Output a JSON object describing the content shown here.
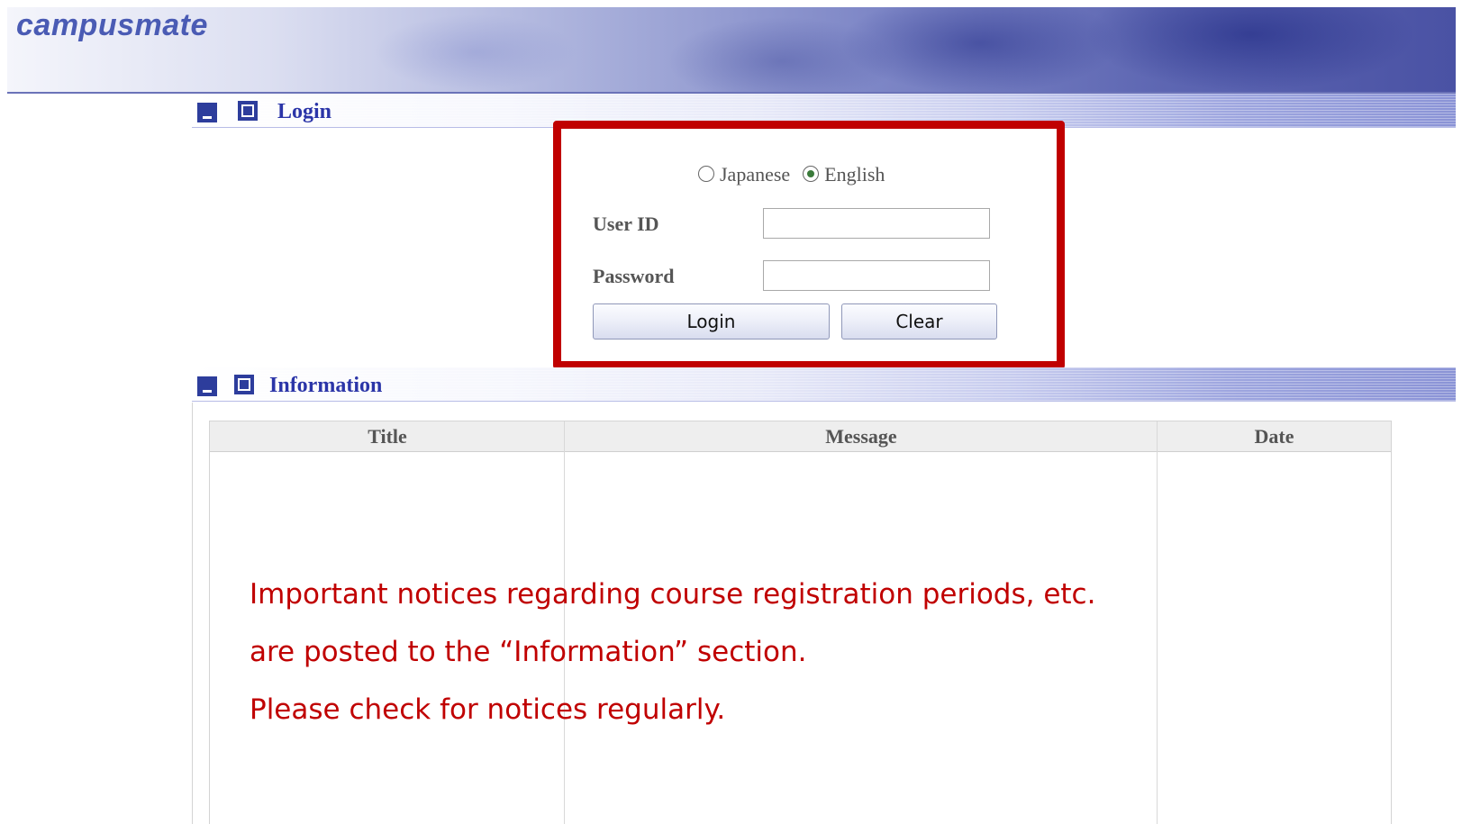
{
  "app": {
    "logo_text": "campusmate"
  },
  "login_section": {
    "title": "Login",
    "language": {
      "options": [
        "Japanese",
        "English"
      ],
      "selected": "English"
    },
    "user_id_label": "User ID",
    "user_id_value": "",
    "password_label": "Password",
    "password_value": "",
    "login_button": "Login",
    "clear_button": "Clear"
  },
  "information_section": {
    "title": "Information",
    "columns": [
      "Title",
      "Message",
      "Date"
    ],
    "rows": []
  },
  "annotation": {
    "lines": [
      "Important notices regarding course registration periods, etc.",
      "are posted to the “Information” section.",
      "Please check for notices regularly."
    ]
  },
  "colors": {
    "section_title": "#2b35a8",
    "section_icon": "#2d3d9c",
    "highlight_border": "#c00000",
    "annotation_text": "#c00000"
  }
}
